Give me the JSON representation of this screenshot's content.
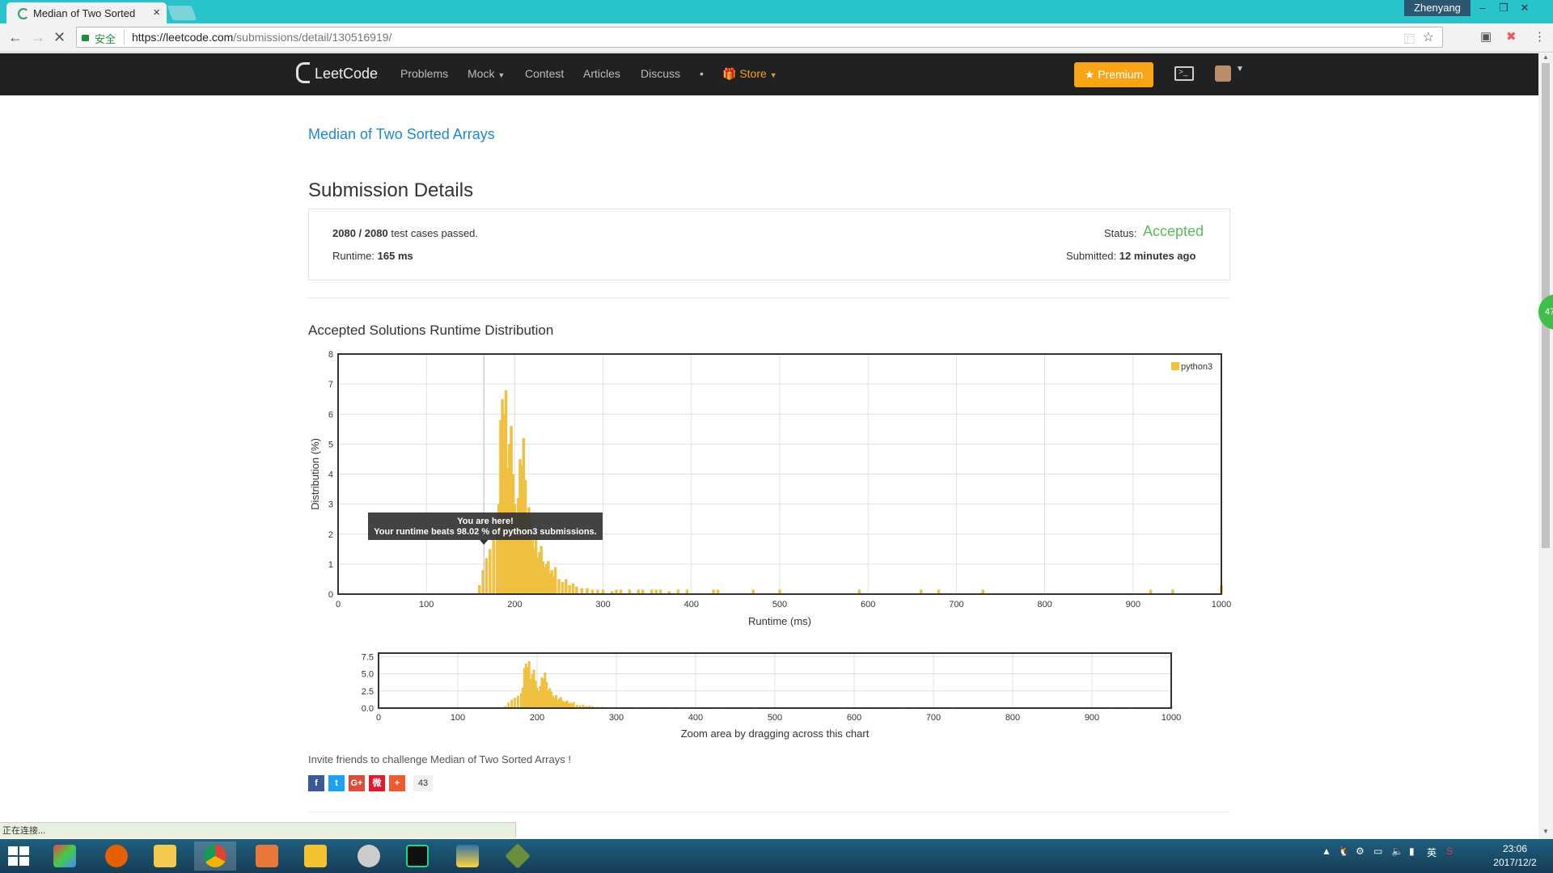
{
  "browser": {
    "tab_title": "Median of Two Sorted",
    "window_user": "Zhenyang",
    "secure_label": "安全",
    "url_base": "https://leetcode.com",
    "url_path": "/submissions/detail/130516919/",
    "status_text": "正在连接..."
  },
  "nav": {
    "logo": "LeetCode",
    "links": [
      "Problems",
      "Mock",
      "Contest",
      "Articles",
      "Discuss",
      "•"
    ],
    "store": "Store",
    "premium": "Premium"
  },
  "page": {
    "problem_title": "Median of Two Sorted Arrays",
    "heading": "Submission Details",
    "passed": "2080",
    "slash": "/",
    "total": "2080",
    "passed_suffix": "test cases passed.",
    "runtime_label": "Runtime:",
    "runtime_value": "165 ms",
    "status_label": "Status:",
    "status_value": "Accepted",
    "submitted_label": "Submitted:",
    "submitted_value": "12 minutes ago",
    "dist_title": "Accepted Solutions Runtime Distribution",
    "invite": "Invite friends to challenge Median of Two Sorted Arrays !",
    "share_count": "43"
  },
  "chart_data": [
    {
      "type": "bar",
      "ylabel": "Distribution (%)",
      "xlabel": "Runtime (ms)",
      "xlim": [
        0,
        1000
      ],
      "ylim": [
        0,
        8
      ],
      "x_ticks": [
        0,
        100,
        200,
        300,
        400,
        500,
        600,
        700,
        800,
        900,
        1000
      ],
      "y_ticks": [
        0,
        1,
        2,
        3,
        4,
        5,
        6,
        7,
        8
      ],
      "legend": "python3",
      "legend_position": "top-right",
      "bar_color": "#f0c040",
      "tooltip_title": "You are here!",
      "tooltip_text": "Your runtime beats 98.02 % of python3 submissions.",
      "highlight_x": 165,
      "series": [
        {
          "name": "python3",
          "x": [
            160,
            164,
            168,
            172,
            176,
            180,
            182,
            184,
            186,
            188,
            190,
            192,
            194,
            196,
            198,
            200,
            202,
            204,
            206,
            208,
            210,
            212,
            214,
            216,
            218,
            220,
            222,
            224,
            226,
            228,
            230,
            232,
            234,
            236,
            238,
            240,
            242,
            244,
            246,
            250,
            254,
            258,
            262,
            266,
            270,
            276,
            282,
            288,
            294,
            300,
            310,
            315,
            320,
            330,
            340,
            345,
            355,
            360,
            365,
            375,
            385,
            395,
            425,
            430,
            470,
            500,
            590,
            660,
            680,
            730,
            920,
            945,
            1000
          ],
          "values": [
            0.3,
            0.8,
            1.2,
            1.5,
            1.8,
            2.2,
            3.0,
            5.8,
            6.5,
            6.0,
            6.8,
            4.2,
            5.0,
            5.6,
            4.0,
            3.0,
            2.5,
            3.2,
            4.5,
            4.3,
            5.2,
            3.8,
            2.6,
            2.9,
            2.4,
            1.8,
            1.5,
            1.9,
            1.2,
            1.4,
            1.6,
            1.1,
            0.9,
            1.0,
            1.1,
            0.7,
            0.8,
            0.6,
            0.9,
            0.5,
            0.4,
            0.5,
            0.3,
            0.35,
            0.25,
            0.2,
            0.2,
            0.15,
            0.15,
            0.15,
            0.1,
            0.15,
            0.15,
            0.15,
            0.15,
            0.15,
            0.15,
            0.15,
            0.15,
            0.1,
            0.15,
            0.15,
            0.15,
            0.15,
            0.15,
            0.15,
            0.15,
            0.15,
            0.15,
            0.15,
            0.15,
            0.15,
            0.3
          ]
        }
      ]
    },
    {
      "type": "bar",
      "xlabel": "Zoom area by dragging across this chart",
      "xlim": [
        0,
        1000
      ],
      "ylim": [
        0,
        8
      ],
      "x_ticks": [
        0,
        100,
        200,
        300,
        400,
        500,
        600,
        700,
        800,
        900,
        1000
      ],
      "y_ticks": [
        "0.0",
        "2.5",
        "5.0",
        "7.5"
      ],
      "series_ref": "python3"
    }
  ],
  "taskbar": {
    "clock_time": "23:06",
    "clock_date": "2017/12/2",
    "ime": "英"
  }
}
